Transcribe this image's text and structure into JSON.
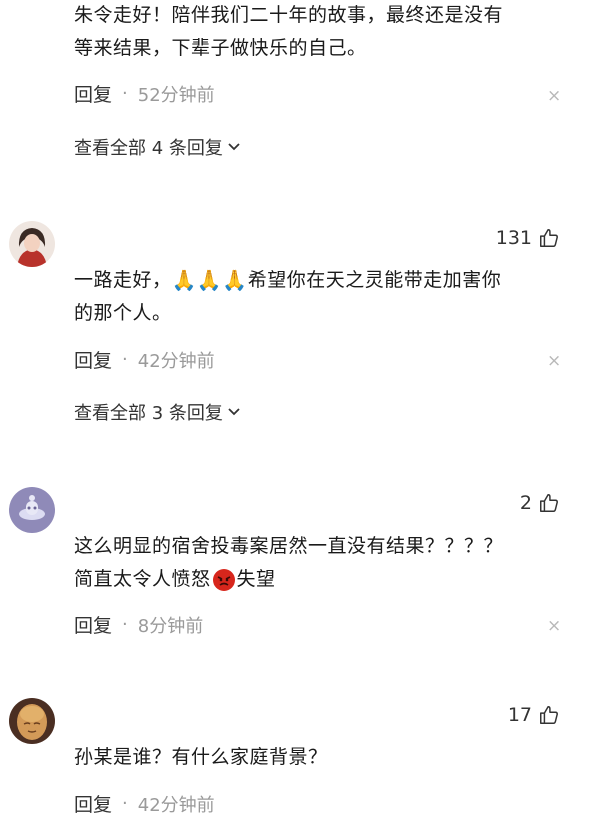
{
  "comments": [
    {
      "line1": "朱令走好！陪伴我们二十年的故事，最终还是没有",
      "line2": "等来结果，下辈子做快乐的自己。",
      "reply_label": "回复",
      "separator": "·",
      "time": "52分钟前",
      "view_replies": "查看全部 4 条回复"
    },
    {
      "likes": "131",
      "line1_pre": "一路走好，",
      "emoji": "🙏",
      "line1_post": "希望你在天之灵能带走加害你",
      "line2": "的那个人。",
      "reply_label": "回复",
      "separator": "·",
      "time": "42分钟前",
      "view_replies": "查看全部 3 条回复"
    },
    {
      "likes": "2",
      "line1": "这么明显的宿舍投毒案居然一直没有结果？？？？",
      "line2_pre": "简直太令人愤怒",
      "line2_post": "失望",
      "reply_label": "回复",
      "separator": "·",
      "time": "8分钟前"
    },
    {
      "likes": "17",
      "line1": "孙某是谁？有什么家庭背景？",
      "reply_label": "回复",
      "separator": "·",
      "time": "42分钟前"
    }
  ],
  "close_glyph": "×",
  "icons": {
    "like": "thumbs-up-icon",
    "close": "close-icon",
    "chevron": "chevron-down-icon"
  }
}
